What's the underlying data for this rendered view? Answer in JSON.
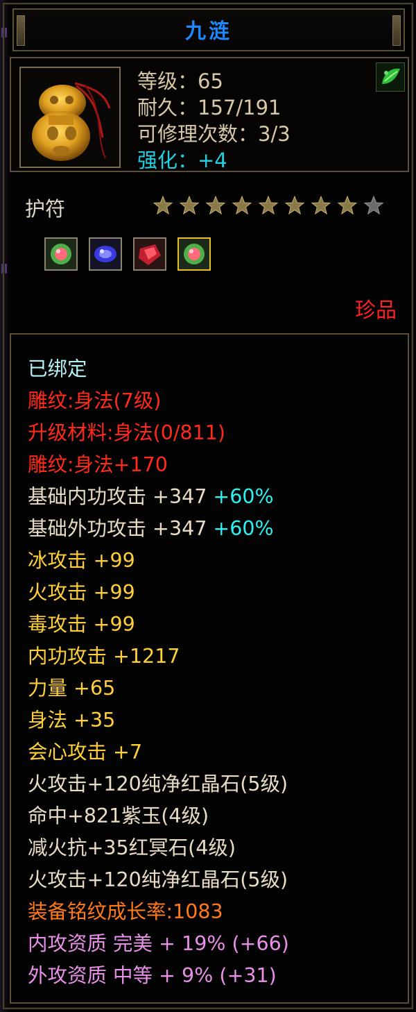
{
  "tooltip": {
    "title": "九涟",
    "header": {
      "level": "等级：65",
      "durability": "耐久：157/191",
      "repairs": "可修理次数：3/3",
      "enhance": "强化：+4"
    },
    "item_type": "护符",
    "stars": {
      "filled": 8,
      "total": 9
    },
    "gems": [
      "green-gem-icon",
      "blue-gem-icon",
      "red-gem-icon",
      "green-gem-icon"
    ],
    "rarity": "珍品",
    "stats": {
      "bound": "已绑定",
      "engrave": "雕纹:身法(7级)",
      "upgrade_material": "升级材料:身法(0/811)",
      "engrave_bonus": "雕纹:身法+170",
      "base_internal": {
        "label": "基础内功攻击  +347",
        "pct": "+60%"
      },
      "base_external": {
        "label": "基础外功攻击  +347",
        "pct": "+60%"
      },
      "ice_attack": "冰攻击  +99",
      "fire_attack": "火攻击  +99",
      "poison_attack": "毒攻击  +99",
      "internal_attack": "内功攻击  +1217",
      "strength": "力量  +65",
      "agility": "身法  +35",
      "crit_attack": "会心攻击  +7",
      "socket_1": "火攻击+120纯净红晶石(5级)",
      "socket_2": "命中+821紫玉(4级)",
      "socket_3": "减火抗+35红冥石(4级)",
      "socket_4": "火攻击+120纯净红晶石(5级)",
      "growth": "装备铭纹成长率:1083",
      "internal_quality": "内攻资质  完美  + 19% (+66)",
      "external_quality": "外攻资质  中等  + 9% (+31)"
    },
    "colors": {
      "title": "#1f88ff",
      "enhance": "#20d0e0",
      "rarity": "#ff2020",
      "stat_gold": "#ffcf3a",
      "stat_red": "#ff2a1a",
      "stat_pink": "#e890e8"
    }
  }
}
